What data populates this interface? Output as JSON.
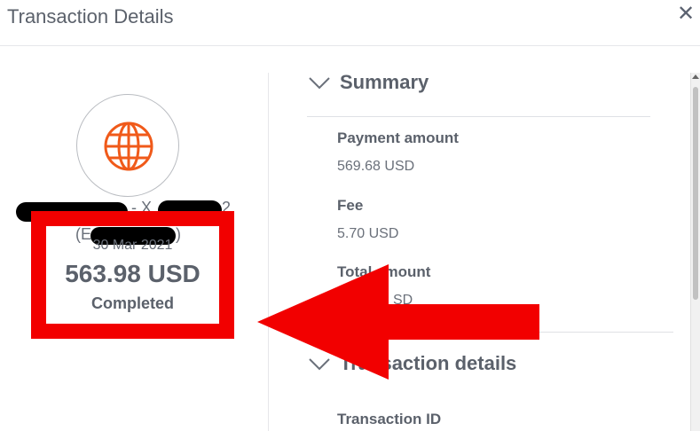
{
  "header": {
    "title": "Transaction Details",
    "close_label": "✕"
  },
  "merchant": {
    "name_separator": "- X",
    "name_suffix": "2",
    "sub_open": "(E",
    "sub_close": ")"
  },
  "transaction": {
    "date": "30 Mar 2021",
    "amount": "563.98 USD",
    "status": "Completed"
  },
  "summary": {
    "heading": "Summary",
    "fields": [
      {
        "label": "Payment amount",
        "value": "569.68 USD"
      },
      {
        "label": "Fee",
        "value": "5.70 USD"
      },
      {
        "label": "Total amount",
        "value": "56",
        "value_suffix": "SD"
      }
    ]
  },
  "details": {
    "heading": "Transaction details",
    "fields": [
      {
        "label": "Transaction ID"
      }
    ]
  },
  "colors": {
    "highlight": "#f20000",
    "icon": "#f05a1a",
    "text": "#5b616b"
  },
  "icons": {
    "merchant": "globe-icon",
    "close": "close-icon",
    "chevron": "chevron-down-icon"
  }
}
